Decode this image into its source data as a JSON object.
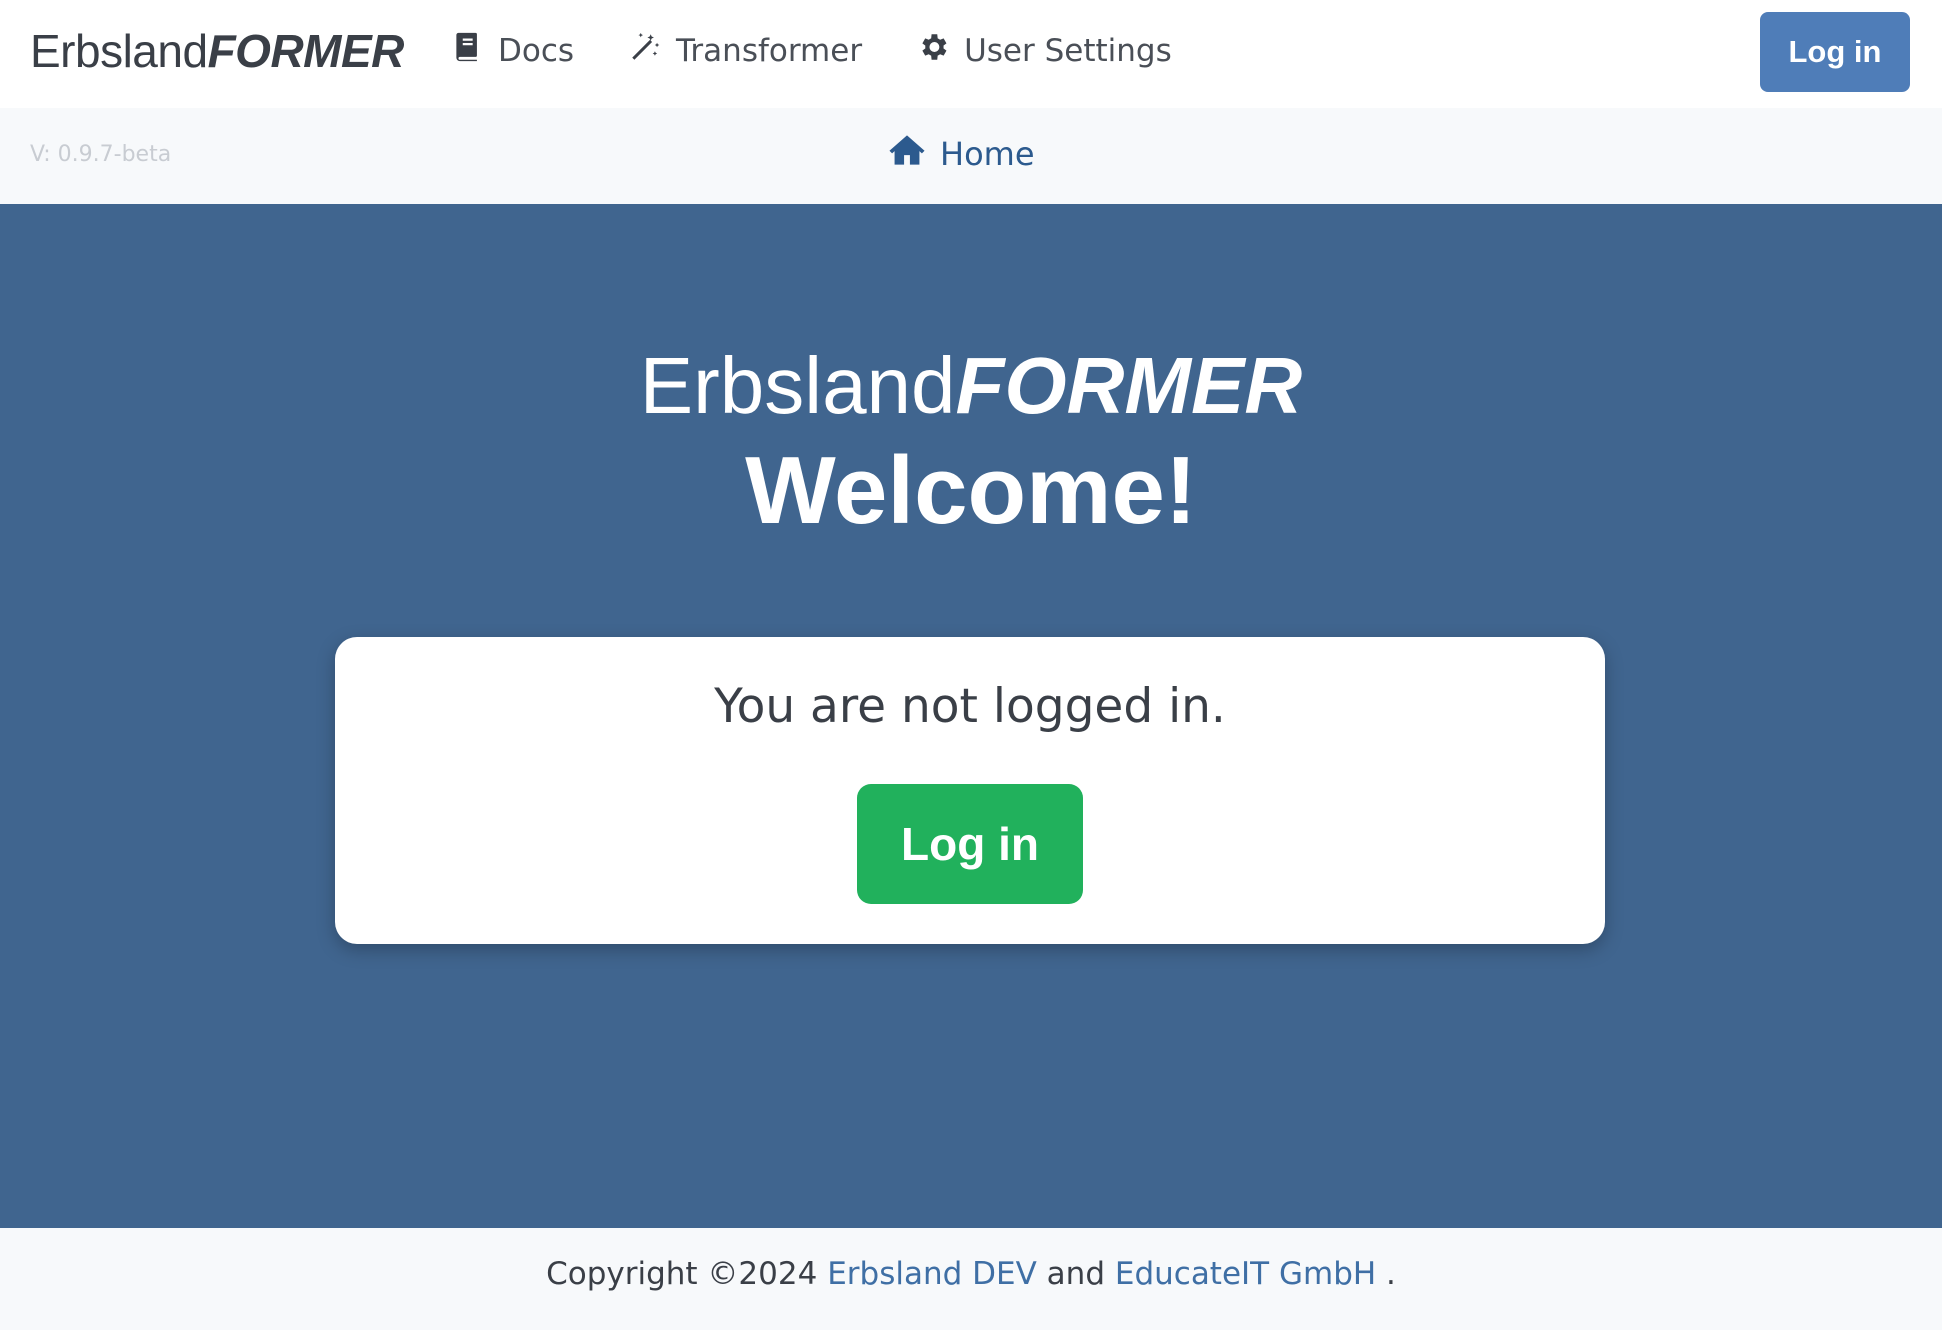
{
  "navbar": {
    "brand": {
      "regular": "Erbsland",
      "bold": "FORMER"
    },
    "links": [
      {
        "label": "Docs",
        "icon": "book-icon"
      },
      {
        "label": "Transformer",
        "icon": "magic-wand-icon"
      },
      {
        "label": "User Settings",
        "icon": "gear-icon"
      }
    ],
    "login_label": "Log in"
  },
  "subbar": {
    "version": "V: 0.9.7-beta",
    "home_label": "Home",
    "home_icon": "home-icon"
  },
  "hero": {
    "brand": {
      "regular": "Erbsland",
      "bold": "FORMER"
    },
    "welcome": "Welcome!"
  },
  "card": {
    "message": "You are not logged in.",
    "login_label": "Log in"
  },
  "footer": {
    "prefix": "Copyright ©2024",
    "link1": "Erbsland DEV",
    "middle": "and",
    "link2": "EducateIT GmbH",
    "suffix": "."
  },
  "colors": {
    "hero_background": "#40658f",
    "primary_button": "#4f7db8",
    "success_button": "#21b15c",
    "link": "#3f6fa5"
  }
}
